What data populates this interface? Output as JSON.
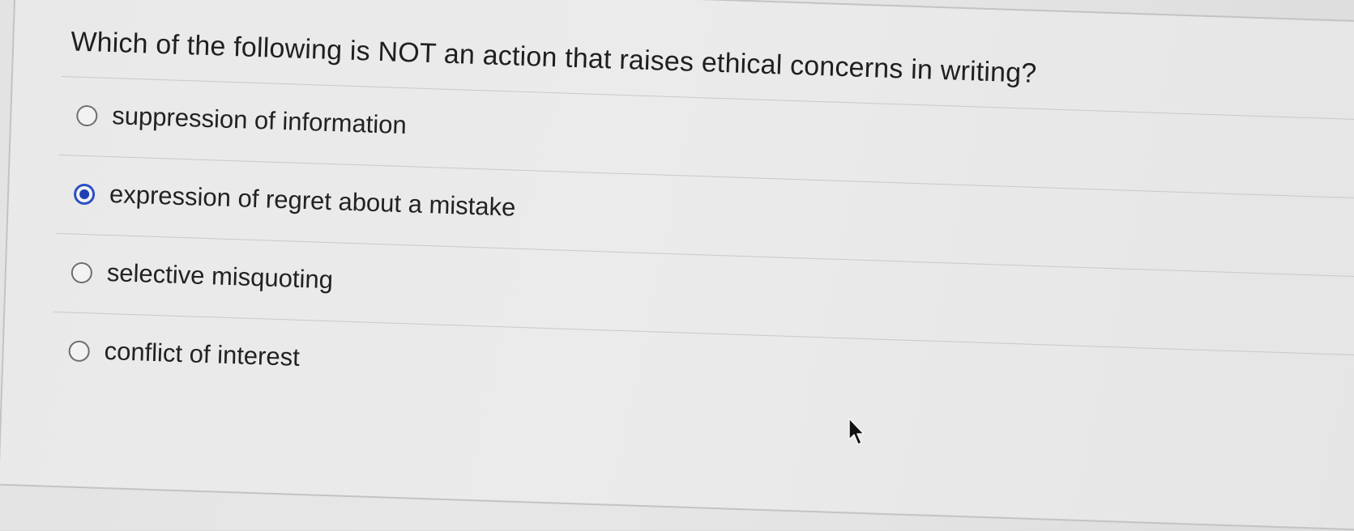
{
  "question": {
    "text": "Which of the following is NOT an action that raises ethical concerns in writing?"
  },
  "options": [
    {
      "label": "suppression of information",
      "selected": false
    },
    {
      "label": "expression of regret about a mistake",
      "selected": true
    },
    {
      "label": "selective misquoting",
      "selected": false
    },
    {
      "label": "conflict of interest",
      "selected": false
    }
  ],
  "colors": {
    "selected_radio": "#1f3fb5",
    "page_background": "#e6e6e6"
  },
  "icons": {
    "cursor": "mouse-pointer-icon"
  }
}
